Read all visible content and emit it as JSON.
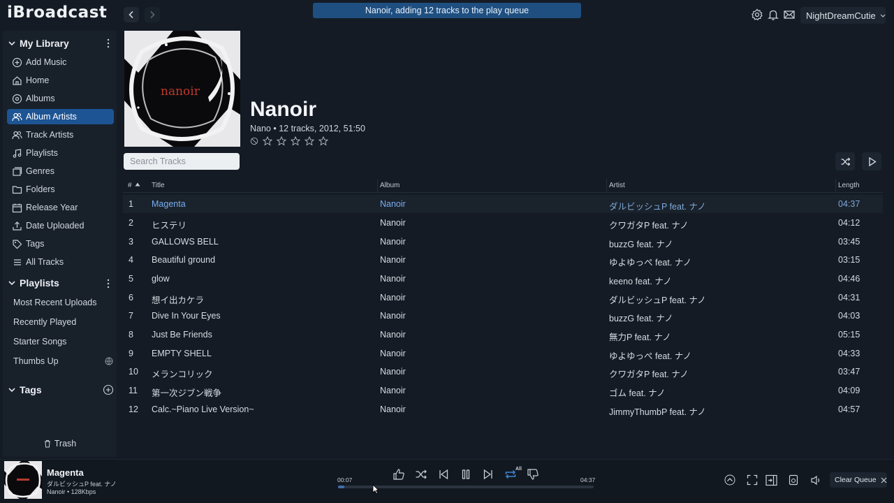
{
  "app": {
    "name": "iBroadcast"
  },
  "toast": {
    "message": "Nanoir, adding 12 tracks to the play queue"
  },
  "user": {
    "name": "NightDreamCutie"
  },
  "sidebar": {
    "library_title": "My Library",
    "library_items": [
      {
        "label": "Add Music",
        "icon": "add-circle-icon"
      },
      {
        "label": "Home",
        "icon": "home-icon"
      },
      {
        "label": "Albums",
        "icon": "disc-icon"
      },
      {
        "label": "Album Artists",
        "icon": "people-icon",
        "active": true
      },
      {
        "label": "Track Artists",
        "icon": "people-icon"
      },
      {
        "label": "Playlists",
        "icon": "music-note-icon"
      },
      {
        "label": "Genres",
        "icon": "stack-icon"
      },
      {
        "label": "Folders",
        "icon": "folder-icon"
      },
      {
        "label": "Release Year",
        "icon": "calendar-icon"
      },
      {
        "label": "Date Uploaded",
        "icon": "upload-icon"
      },
      {
        "label": "Tags",
        "icon": "tag-icon"
      },
      {
        "label": "All Tracks",
        "icon": "list-icon"
      }
    ],
    "playlists_title": "Playlists",
    "playlists": [
      {
        "label": "Most Recent Uploads"
      },
      {
        "label": "Recently Played"
      },
      {
        "label": "Starter Songs"
      },
      {
        "label": "Thumbs Up"
      }
    ],
    "tags_title": "Tags",
    "trash_label": "Trash"
  },
  "album": {
    "title": "Nanoir",
    "meta": "Nano • 12 tracks, 2012, 51:50",
    "art_text": "nanoir",
    "rating": 0
  },
  "search": {
    "placeholder": "Search Tracks"
  },
  "table": {
    "headers": {
      "num": "#",
      "title": "Title",
      "album": "Album",
      "artist": "Artist",
      "length": "Length"
    },
    "rows": [
      {
        "num": "1",
        "title": "Magenta",
        "album": "Nanoir",
        "artist": "ダルビッシュP feat. ナノ",
        "length": "04:37",
        "playing": true
      },
      {
        "num": "2",
        "title": "ヒステリ",
        "album": "Nanoir",
        "artist": "クワガタP feat. ナノ",
        "length": "04:12"
      },
      {
        "num": "3",
        "title": "GALLOWS BELL",
        "album": "Nanoir",
        "artist": "buzzG feat. ナノ",
        "length": "03:45"
      },
      {
        "num": "4",
        "title": "Beautiful ground",
        "album": "Nanoir",
        "artist": "ゆよゆっぺ feat. ナノ",
        "length": "03:15"
      },
      {
        "num": "5",
        "title": "glow",
        "album": "Nanoir",
        "artist": "keeno feat. ナノ",
        "length": "04:46"
      },
      {
        "num": "6",
        "title": "想イ出カケラ",
        "album": "Nanoir",
        "artist": "ダルビッシュP feat. ナノ",
        "length": "04:31"
      },
      {
        "num": "7",
        "title": "Dive In Your Eyes",
        "album": "Nanoir",
        "artist": "buzzG feat. ナノ",
        "length": "04:03"
      },
      {
        "num": "8",
        "title": "Just Be Friends",
        "album": "Nanoir",
        "artist": "無力P feat. ナノ",
        "length": "05:15"
      },
      {
        "num": "9",
        "title": "EMPTY SHELL",
        "album": "Nanoir",
        "artist": "ゆよゆっぺ feat. ナノ",
        "length": "04:33"
      },
      {
        "num": "10",
        "title": "メランコリック",
        "album": "Nanoir",
        "artist": "クワガタP feat. ナノ",
        "length": "03:47"
      },
      {
        "num": "11",
        "title": "第一次ジブン戦争",
        "album": "Nanoir",
        "artist": "ゴム feat. ナノ",
        "length": "04:09"
      },
      {
        "num": "12",
        "title": "Calc.~Piano Live Version~",
        "album": "Nanoir",
        "artist": "JimmyThumbP feat. ナノ",
        "length": "04:57"
      }
    ]
  },
  "player": {
    "title": "Magenta",
    "artist": "ダルビッシュP feat. ナノ",
    "album_info": "Nanoir • 128Kbps",
    "elapsed": "00:07",
    "duration": "04:37",
    "progress_percent": 2.5,
    "repeat_mode": "All",
    "clear_queue_label": "Clear Queue"
  },
  "colors": {
    "accent": "#1d5493",
    "playing_text": "#78aef0",
    "background": "#141b24"
  }
}
